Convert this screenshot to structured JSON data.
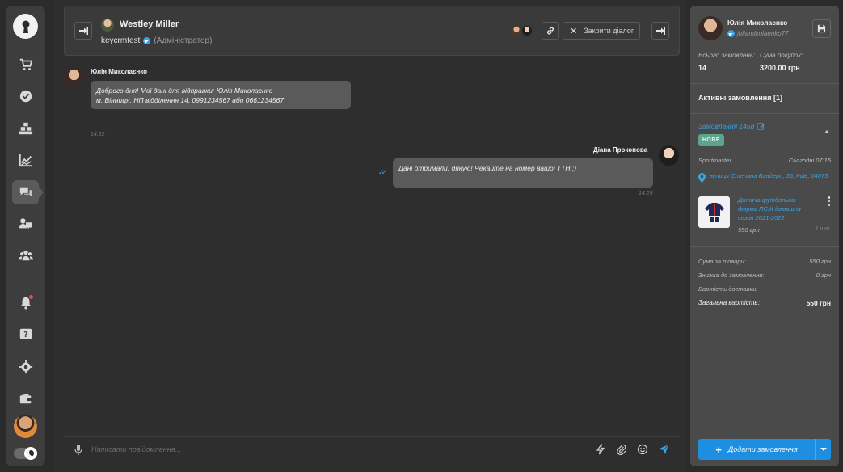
{
  "sidebar": {
    "items": [
      {
        "name": "orders-cart-icon"
      },
      {
        "name": "tasks-check-icon"
      },
      {
        "name": "warehouse-boxes-icon"
      },
      {
        "name": "analytics-chart-icon"
      },
      {
        "name": "chats-icon"
      },
      {
        "name": "contacts-icon"
      },
      {
        "name": "team-icon"
      },
      {
        "name": "notifications-bell-icon"
      },
      {
        "name": "help-icon"
      },
      {
        "name": "settings-gear-icon"
      },
      {
        "name": "wallet-icon"
      }
    ]
  },
  "chat_header": {
    "contact_name": "Westley Miller",
    "account": "keycrmtest",
    "role": "(Адміністратор)",
    "close_dialog_label": "Закрити діалог"
  },
  "messages": [
    {
      "author": "Юлія Миколаєнко",
      "lines": [
        "Доброго дня! Мої дані для відправки: Юлія Миколаєнко",
        "м. Вінниця, НП відділення 14, 0991234567 або 0661234567"
      ],
      "time": "14:22"
    },
    {
      "author": "Діана Прокопова",
      "lines": [
        "Дані отримали, дякую! Чекайте на номер вашої ТТН :)"
      ],
      "time": "14:25"
    }
  ],
  "composer": {
    "placeholder": "Написати повідомлення..."
  },
  "panel": {
    "customer_name": "Юлія Миколаєнко",
    "username": "juliamikolaenko77",
    "total_orders_label": "Всього замовлень:",
    "total_orders_value": "14",
    "purchases_sum_label": "Сума покупок:",
    "purchases_sum_value": "3200.00 грн",
    "active_orders_title": "Активні замовлення [1]",
    "order": {
      "link": "Замовлення 1458",
      "status": "НОВЕ",
      "source": "Sportmaster",
      "date": "Сьогодні 07:15",
      "address": "вулиця Степана Бандери, 36, Київ, 04073",
      "product_name": "Дитяча футбольна форма ПСЖ домашня сезон 2021-2022",
      "product_price": "550 грн",
      "product_qty": "1 шт."
    },
    "summary": [
      {
        "label": "Сума за товари:",
        "value": "550 грн"
      },
      {
        "label": "Знижка до замовлення:",
        "value": "0 грн"
      },
      {
        "label": "Вартість доставки:",
        "value": "-"
      }
    ],
    "total_label": "Загальна вартість:",
    "total_value": "550 грн",
    "add_order_label": "Додати замовлення"
  },
  "colors": {
    "accent": "#1e8fe0",
    "telegram": "#3aa3e3",
    "status_new": "#5ba58f"
  }
}
